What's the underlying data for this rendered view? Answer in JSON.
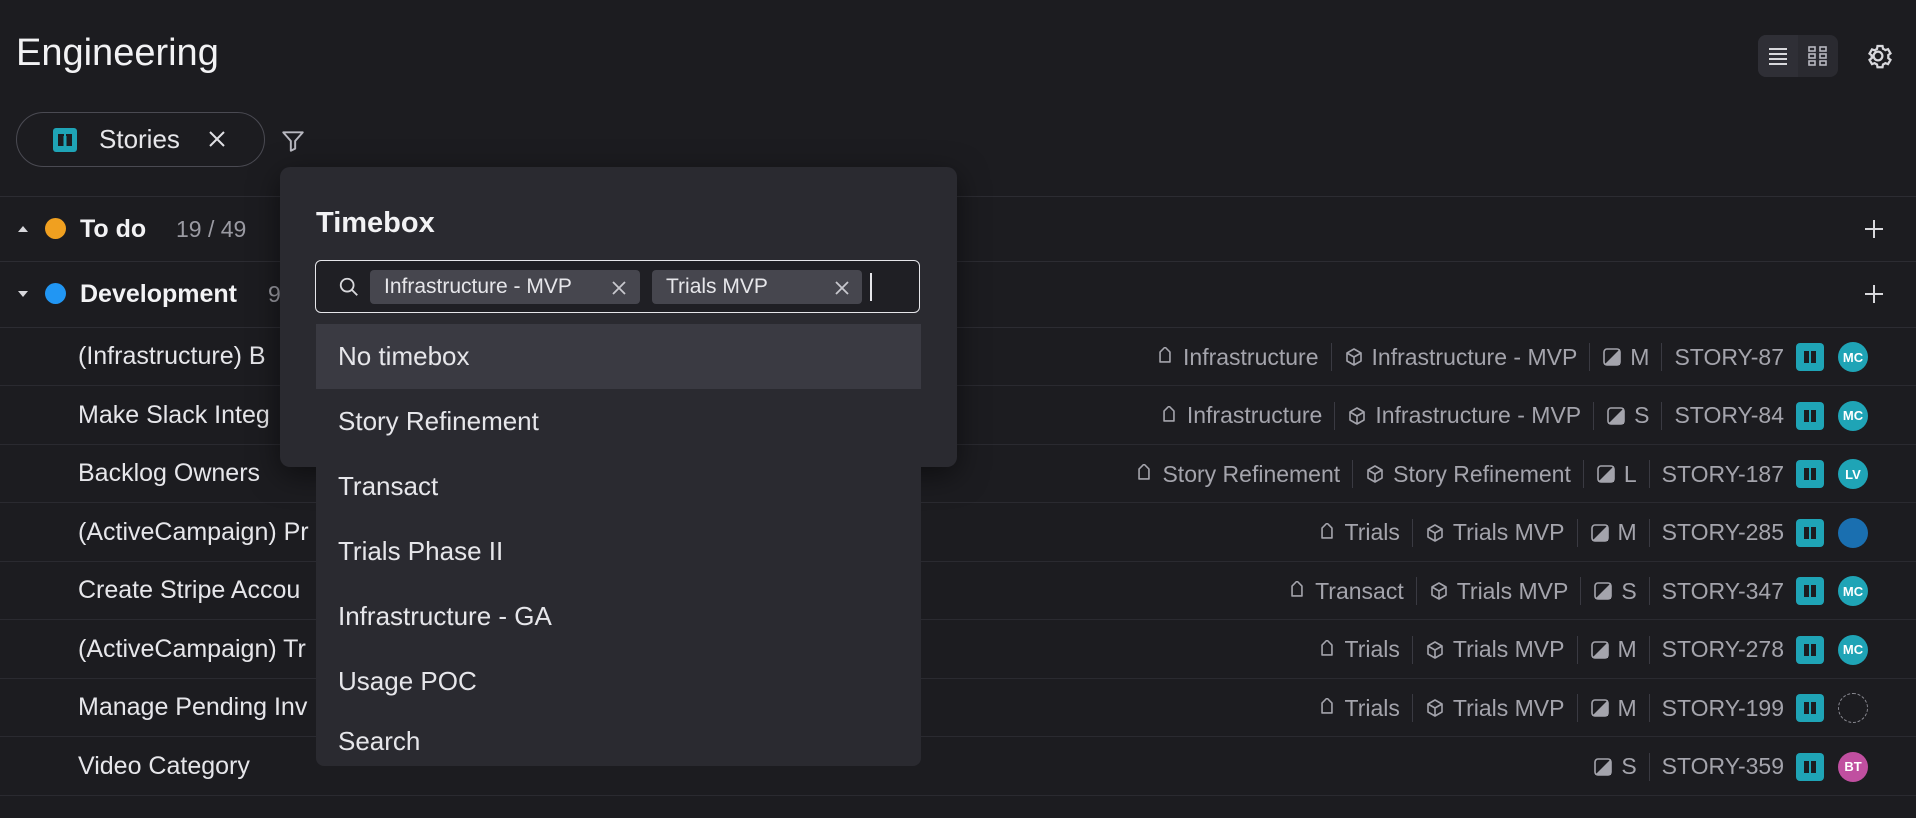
{
  "header": {
    "title": "Engineering",
    "list_view_icon": "list-view-icon",
    "grid_view_icon": "grid-view-icon",
    "settings_icon": "gear-icon"
  },
  "filter_chip": {
    "label": "Stories",
    "icon": "book-icon"
  },
  "groups": [
    {
      "name": "To do",
      "count": "19 / 49",
      "color": "#f0a020",
      "expanded": false
    },
    {
      "name": "Development",
      "count": "9",
      "color": "#2196f3",
      "expanded": true
    }
  ],
  "items": [
    {
      "title": "(Infrastructure) B",
      "epic": "Infrastructure",
      "timebox": "Infrastructure - MVP",
      "size": "M",
      "key": "STORY-87",
      "avatar": "MC",
      "avatar_color": "#1fa4b6"
    },
    {
      "title": "Make Slack Integ",
      "epic": "Infrastructure",
      "timebox": "Infrastructure - MVP",
      "size": "S",
      "key": "STORY-84",
      "avatar": "MC",
      "avatar_color": "#1fa4b6"
    },
    {
      "title": "Backlog Owners",
      "epic": "Story Refinement",
      "timebox": "Story Refinement",
      "size": "L",
      "key": "STORY-187",
      "avatar": "LV",
      "avatar_color": "#1fa4b6"
    },
    {
      "title": "(ActiveCampaign) Pr",
      "epic": "Trials",
      "timebox": "Trials MVP",
      "size": "M",
      "key": "STORY-285",
      "avatar": "",
      "avatar_color": "#1a6fb0"
    },
    {
      "title": "Create Stripe Accou",
      "epic": "Transact",
      "timebox": "Trials MVP",
      "size": "S",
      "key": "STORY-347",
      "avatar": "MC",
      "avatar_color": "#1fa4b6"
    },
    {
      "title": "(ActiveCampaign) Tr",
      "epic": "Trials",
      "timebox": "Trials MVP",
      "size": "M",
      "key": "STORY-278",
      "avatar": "MC",
      "avatar_color": "#1fa4b6"
    },
    {
      "title": "Manage Pending Inv",
      "epic": "Trials",
      "timebox": "Trials MVP",
      "size": "M",
      "key": "STORY-199",
      "avatar": "",
      "avatar_color": ""
    },
    {
      "title": "Video Category",
      "epic": "",
      "timebox": "",
      "size": "S",
      "key": "STORY-359",
      "avatar": "BT",
      "avatar_color": "#c04fa0"
    }
  ],
  "popover": {
    "title": "Timebox",
    "selected_tags": [
      "Infrastructure - MVP",
      "Trials MVP"
    ],
    "options": [
      "No timebox",
      "Story Refinement",
      "Transact",
      "Trials Phase II",
      "Infrastructure - GA",
      "Usage POC",
      "Search"
    ],
    "highlighted_option": "No timebox"
  }
}
